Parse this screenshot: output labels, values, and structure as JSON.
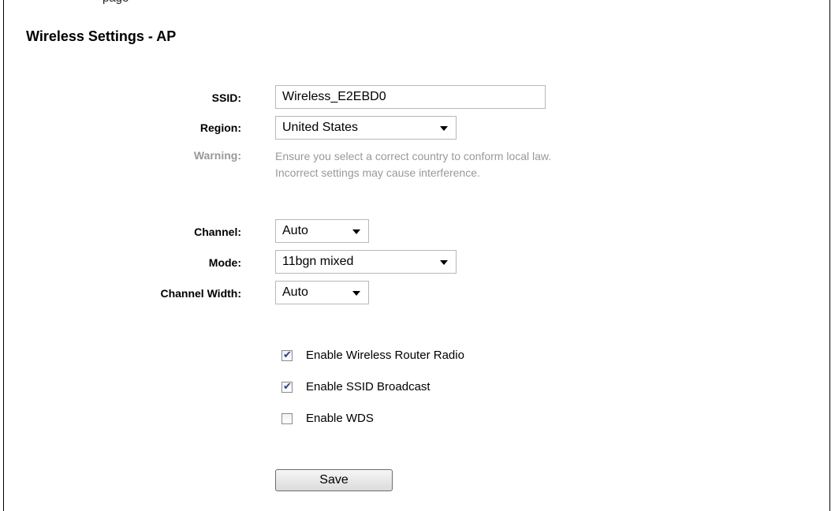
{
  "header": {
    "page_title": "Wireless Settings - AP",
    "top_fragment": "page"
  },
  "form": {
    "ssid": {
      "label": "SSID:",
      "value": "Wireless_E2EBD0"
    },
    "region": {
      "label": "Region:",
      "value": "United States"
    },
    "warning": {
      "label": "Warning:",
      "line1": "Ensure you select a correct country to conform local law.",
      "line2": "Incorrect settings may cause interference."
    },
    "channel": {
      "label": "Channel:",
      "value": "Auto"
    },
    "mode": {
      "label": "Mode:",
      "value": "11bgn mixed"
    },
    "channel_width": {
      "label": "Channel Width:",
      "value": "Auto"
    }
  },
  "options": [
    {
      "label": "Enable Wireless Router Radio",
      "checked": true
    },
    {
      "label": "Enable SSID Broadcast",
      "checked": true
    },
    {
      "label": "Enable WDS",
      "checked": false
    }
  ],
  "actions": {
    "save_label": "Save"
  },
  "colors": {
    "muted_text": "#999999",
    "checkmark": "#2a3f8c"
  }
}
